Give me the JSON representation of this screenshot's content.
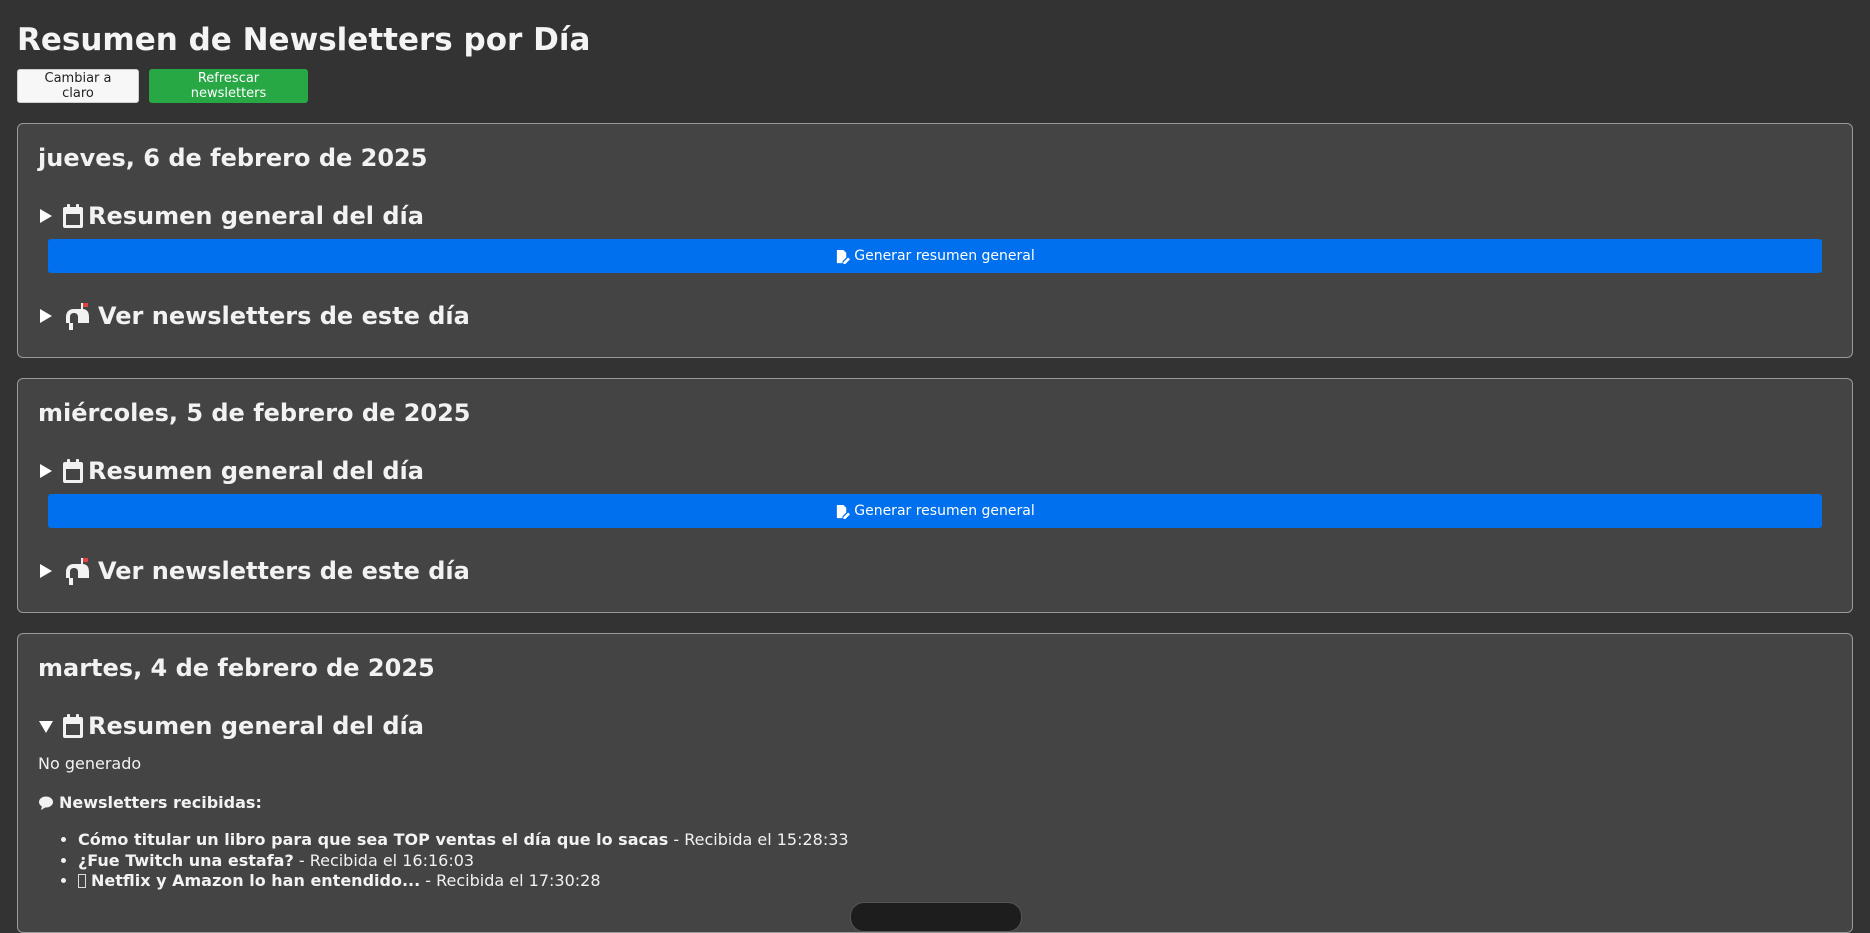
{
  "header": {
    "title": "Resumen de Newsletters por Día",
    "theme_button": "Cambiar a claro",
    "refresh_button": "Refrescar newsletters"
  },
  "colors": {
    "background": "#333333",
    "card": "#444444",
    "primary": "#0070ef",
    "success": "#28a745"
  },
  "days": [
    {
      "date": "jueves, 6 de febrero de 2025",
      "summary_label": "Resumen general del día",
      "summary_expanded": false,
      "generate_button": "Generar resumen general",
      "newsletters_label": "Ver newsletters de este día"
    },
    {
      "date": "miércoles, 5 de febrero de 2025",
      "summary_label": "Resumen general del día",
      "summary_expanded": false,
      "generate_button": "Generar resumen general",
      "newsletters_label": "Ver newsletters de este día"
    },
    {
      "date": "martes, 4 de febrero de 2025",
      "summary_label": "Resumen general del día",
      "summary_expanded": true,
      "status": "No generado",
      "received_label": "Newsletters recibidas:",
      "newsletters": [
        {
          "title": "Cómo titular un libro para que sea TOP ventas el día que lo sacas",
          "received": " - Recibida el 15:28:33"
        },
        {
          "title": "¿Fue Twitch una estafa?",
          "received": " - Recibida el 16:16:03"
        },
        {
          "title": "Netflix y Amazon lo han entendido...",
          "received": " - Recibida el 17:30:28"
        }
      ]
    }
  ],
  "icons": {
    "collapsed": "triangle-right-icon",
    "expanded": "triangle-down-icon",
    "calendar": "calendar-icon",
    "mailbox": "mailbox-icon",
    "edit": "edit-document-icon",
    "speech": "speech-bubble-icon"
  }
}
